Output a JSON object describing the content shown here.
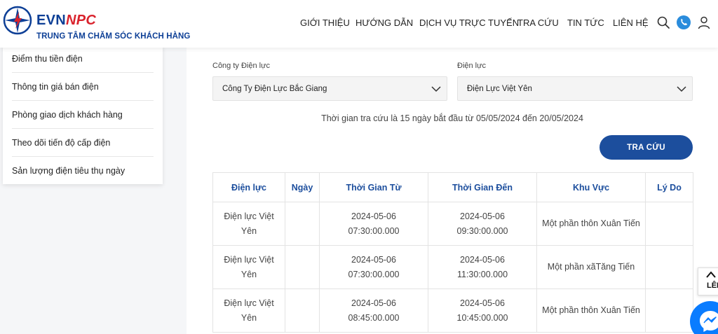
{
  "header": {
    "brand_evn": "EVN",
    "brand_npc": "NPC",
    "brand_subtitle": "TRUNG TÂM CHĂM SÓC KHÁCH HÀNG",
    "nav": [
      {
        "label": "GIỚI THIỆU"
      },
      {
        "label": "HƯỚNG DẪN"
      },
      {
        "label": "DỊCH VỤ TRỰC TUYẾN"
      },
      {
        "label": "TRA CỨU"
      },
      {
        "label": "TIN TỨC"
      },
      {
        "label": "LIÊN HỆ"
      }
    ],
    "icons": [
      "search-icon",
      "phone-icon",
      "user-icon"
    ],
    "accent_color": "#1c4e9d",
    "brand_red": "#d9232d"
  },
  "sidebar": {
    "items": [
      {
        "label": "Điểm thu tiền điện"
      },
      {
        "label": "Thông tin giá bán điện"
      },
      {
        "label": "Phòng giao dịch khách hàng"
      },
      {
        "label": "Theo dõi tiến độ cấp điện"
      },
      {
        "label": "Sản lượng điện tiêu thụ ngày"
      }
    ]
  },
  "filters": {
    "company_label": "Công ty Điện lực",
    "company_value": "Công Ty Điện Lực Bắc Giang",
    "branch_label": "Điện lực",
    "branch_value": "Điện Lực Việt Yên",
    "period_text": "Thời gian tra cứu là 15 ngày bắt đầu từ 05/05/2024 đến 20/05/2024",
    "search_button": "TRA CỨU"
  },
  "table": {
    "headers": [
      "Điện lực",
      "Ngày",
      "Thời Gian Từ",
      "Thời Gian Đến",
      "Khu Vực",
      "Lý Do"
    ],
    "rows": [
      {
        "dien_luc_1": "Điện lực Việt",
        "dien_luc_2": "Yên",
        "ngay": "",
        "tu_1": "2024-05-06",
        "tu_2": "07:30:00.000",
        "den_1": "2024-05-06",
        "den_2": "09:30:00.000",
        "khu_vuc": "Một phần thôn Xuân Tiến",
        "ly_do": ""
      },
      {
        "dien_luc_1": "Điện lực Việt",
        "dien_luc_2": "Yên",
        "ngay": "",
        "tu_1": "2024-05-06",
        "tu_2": "07:30:00.000",
        "den_1": "2024-05-06",
        "den_2": "11:30:00.000",
        "khu_vuc": "Một phần xãTăng Tiến",
        "ly_do": ""
      },
      {
        "dien_luc_1": "Điện lực Việt",
        "dien_luc_2": "Yên",
        "ngay": "",
        "tu_1": "2024-05-06",
        "tu_2": "08:45:00.000",
        "den_1": "2024-05-06",
        "den_2": "10:45:00.000",
        "khu_vuc": "Một phần thôn Xuân Tiến",
        "ly_do": ""
      }
    ]
  },
  "widgets": {
    "back_to_top": "LÊN",
    "messenger_icon": "messenger-icon"
  }
}
